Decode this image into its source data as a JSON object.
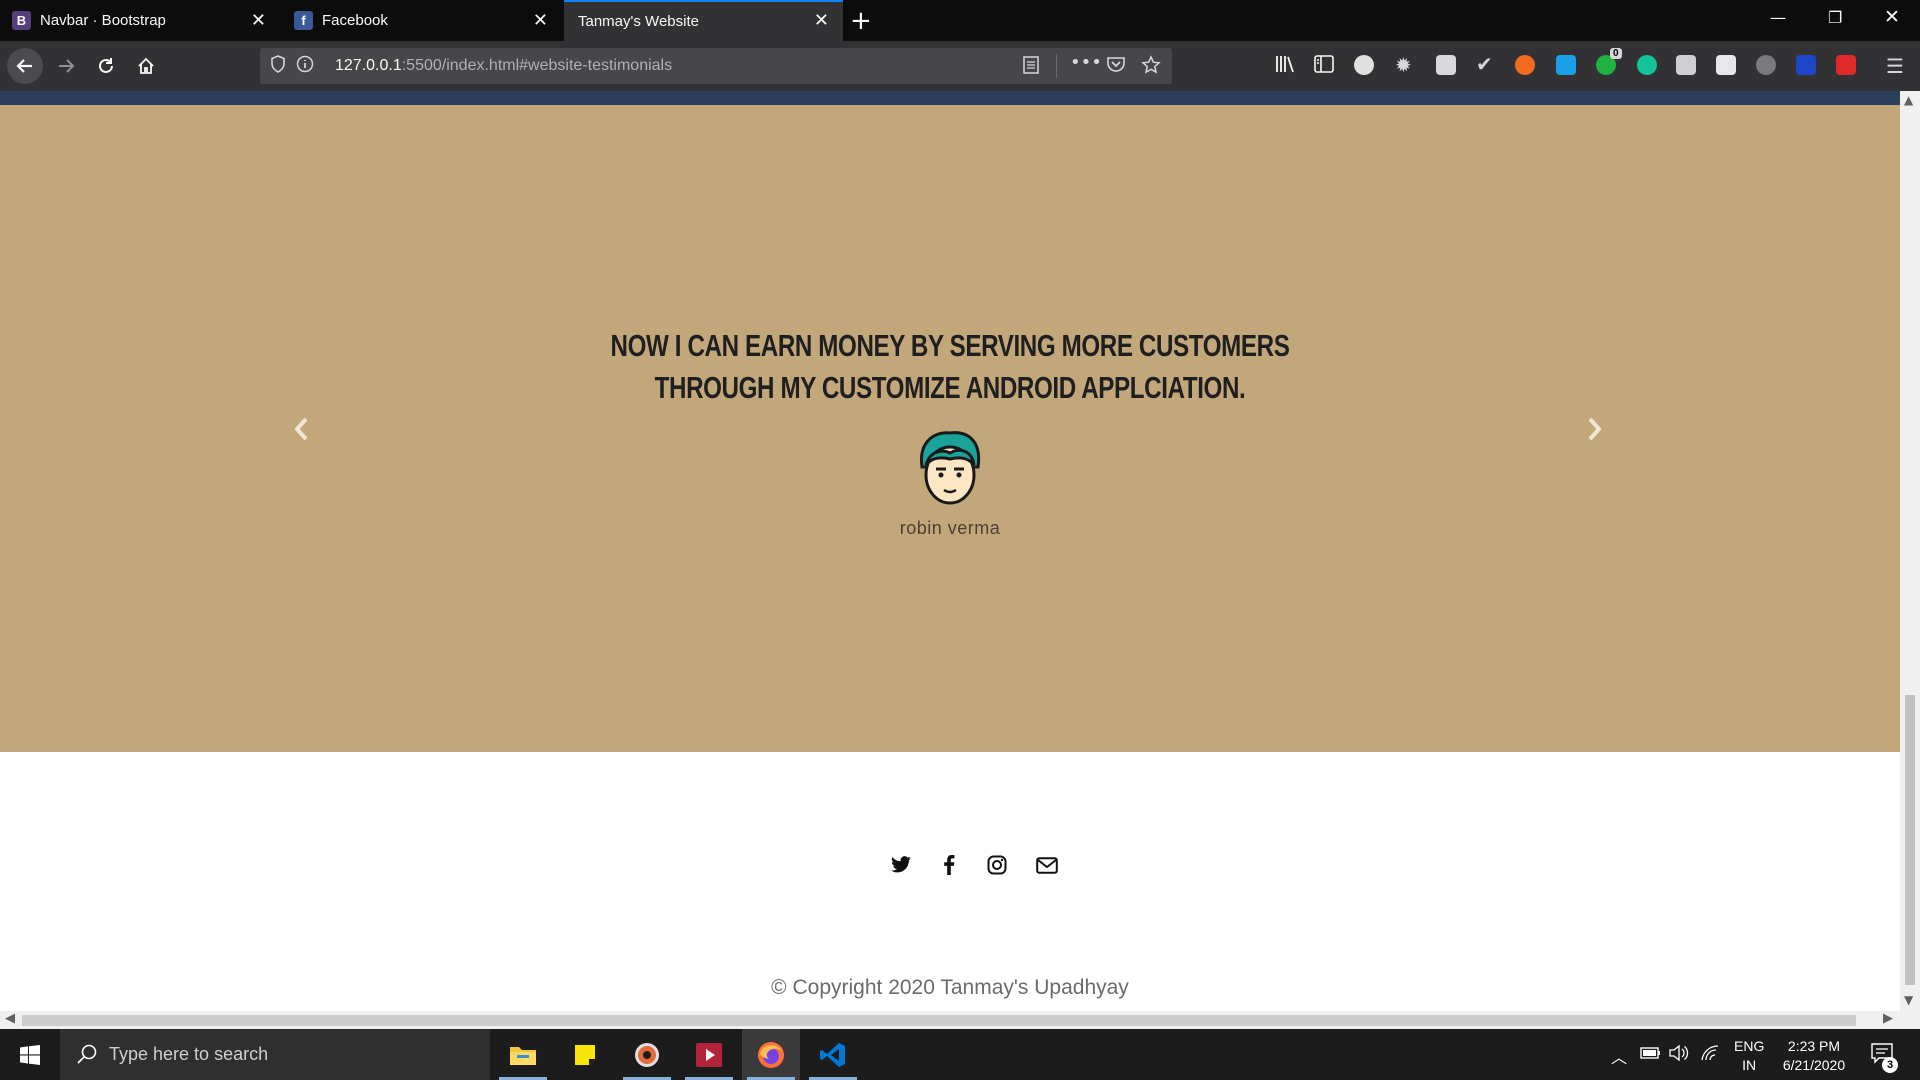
{
  "browser": {
    "tabs": [
      {
        "label": "Navbar · Bootstrap",
        "icon": "bootstrap-icon",
        "favicon_text": "B",
        "color": "#563d7c"
      },
      {
        "label": "Facebook",
        "icon": "facebook-icon",
        "favicon_text": "f",
        "color": "#3b5998"
      },
      {
        "label": "Tanmay's Website",
        "icon": "",
        "active": true
      }
    ],
    "url": {
      "host": "127.0.0.1",
      "rest": ":5500/index.html#website-testimonials"
    },
    "extension_badge": "0"
  },
  "page": {
    "testimonial": {
      "quote_line1": "NOW I CAN EARN MONEY BY SERVING MORE CUSTOMERS",
      "quote_line2": "THROUGH MY CUSTOMIZE ANDROID APPLCIATION.",
      "name": "robin verma",
      "background": "#c2a77a"
    },
    "footer": {
      "social": [
        "twitter-icon",
        "facebook-icon",
        "instagram-icon",
        "email-icon"
      ],
      "copyright": "© Copyright 2020 Tanmay's Upadhyay"
    }
  },
  "taskbar": {
    "search_placeholder": "Type here to search",
    "language_line1": "ENG",
    "language_line2": "IN",
    "time": "2:23 PM",
    "date": "6/21/2020",
    "notification_count": "3"
  }
}
